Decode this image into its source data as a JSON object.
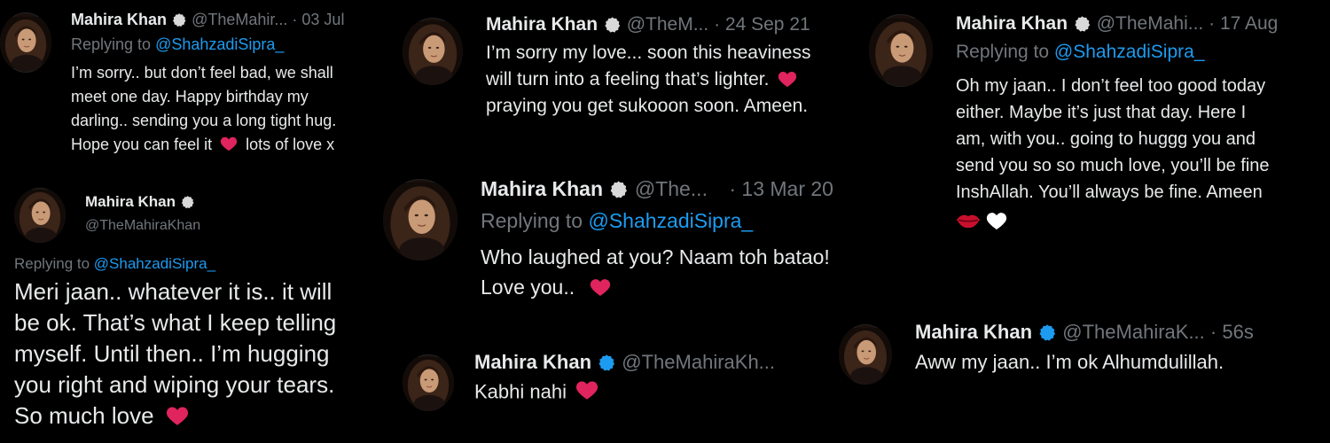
{
  "tweets": [
    {
      "name": "Mahira Khan",
      "handle": "@TheMahir...",
      "sep": "·",
      "date": "03 Jul",
      "reply_prefix": "Replying to",
      "reply_to": "@ShahzadiSipra_",
      "lines": [
        "I’m sorry.. but don’t feel bad, we shall",
        "meet one day. Happy birthday my",
        "darling.. sending you a long tight hug.",
        "Hope you can feel it",
        "lots of love x"
      ]
    },
    {
      "name": "Mahira Khan",
      "handle": "@TheMahiraKhan",
      "reply_prefix": "Replying to",
      "reply_to": "@ShahzadiSipra_",
      "lines": [
        "Meri jaan.. whatever it is.. it will",
        "be ok. That’s what I keep telling",
        "myself. Until then.. I’m hugging",
        "you right and wiping your tears.",
        "So much love"
      ]
    },
    {
      "name": "Mahira Khan",
      "handle": "@TheM...",
      "sep": "·",
      "date": "24 Sep 21",
      "lines": [
        "I’m sorry my love... soon this heaviness",
        "will turn into a feeling that’s lighter.",
        "praying you get sukooon soon. Ameen."
      ]
    },
    {
      "name": "Mahira Khan",
      "handle": "@The...",
      "sep": "·",
      "date": "13 Mar 20",
      "reply_prefix": "Replying to",
      "reply_to": "@ShahzadiSipra_",
      "lines": [
        "Who laughed at you? Naam toh batao!",
        "Love you.."
      ]
    },
    {
      "name": "Mahira Khan",
      "handle": "@TheMahiraKh...",
      "lines": [
        "Kabhi nahi"
      ]
    },
    {
      "name": "Mahira Khan",
      "handle": "@TheMahi...",
      "sep": "·",
      "date": "17 Aug",
      "reply_prefix": "Replying to",
      "reply_to": "@ShahzadiSipra_",
      "lines": [
        "Oh my jaan.. I don’t feel too good today",
        "either. Maybe it’s just that day. Here I",
        "am, with you.. going to huggg you and",
        "send you so so much love, you’ll be fine",
        "InshAllah. You’ll always be fine. Ameen"
      ]
    },
    {
      "name": "Mahira Khan",
      "handle": "@TheMahiraK...",
      "sep": "·",
      "date": "56s",
      "lines": [
        "Aww my jaan.. I’m ok Alhumdulillah."
      ]
    }
  ],
  "icons": {
    "verified": "verified-badge-icon",
    "heart": "red-heart-icon",
    "lips": "kiss-lips-icon",
    "white_heart": "white-heart-icon"
  },
  "colors": {
    "background": "#000000",
    "text": "#e7e9ea",
    "muted": "#71767b",
    "link": "#1d9bf0",
    "heart": "#e0245e",
    "verified_grey": "#d9d9d9",
    "verified_blue": "#1d9bf0"
  }
}
